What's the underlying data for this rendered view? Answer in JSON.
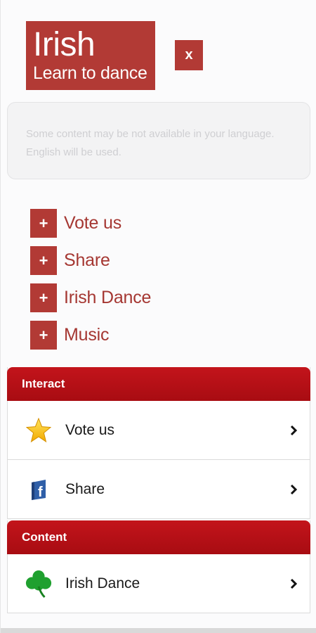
{
  "header": {
    "title": "Irish",
    "subtitle": "Learn to dance",
    "close_label": "x"
  },
  "notice": {
    "text": "Some content may be not available in your language. English will be used."
  },
  "quick_links": [
    {
      "icon": "+",
      "label": "Vote us"
    },
    {
      "icon": "+",
      "label": "Share"
    },
    {
      "icon": "+",
      "label": "Irish Dance"
    },
    {
      "icon": "+",
      "label": "Music"
    }
  ],
  "sections": {
    "interact": {
      "title": "Interact",
      "items": [
        {
          "label": "Vote us",
          "icon": "star-icon"
        },
        {
          "label": "Share",
          "icon": "facebook-icon"
        }
      ]
    },
    "content": {
      "title": "Content",
      "items": [
        {
          "label": "Irish Dance",
          "icon": "shamrock-icon"
        }
      ]
    }
  },
  "colors": {
    "brand_red": "#b23a35",
    "section_red": "#b50f15",
    "link_red": "#a53732"
  }
}
